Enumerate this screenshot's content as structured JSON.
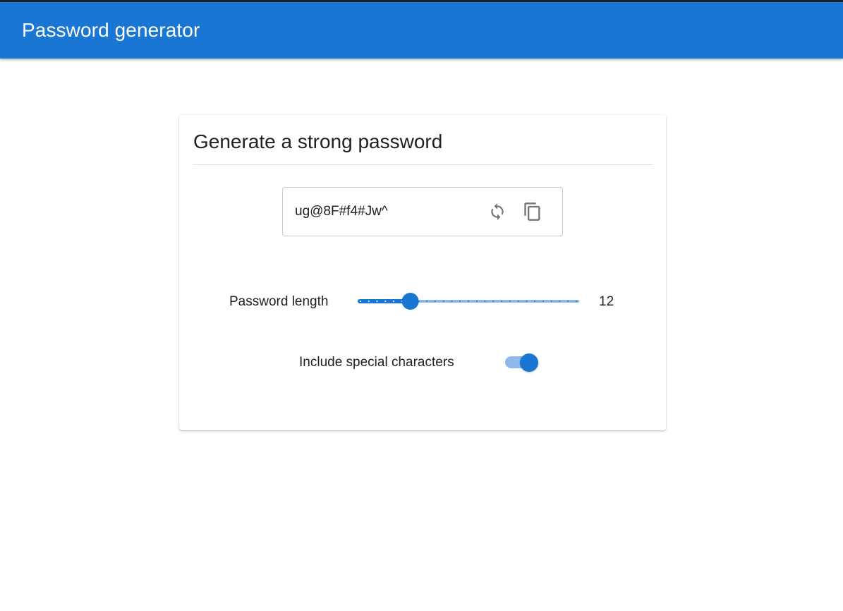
{
  "appbar": {
    "title": "Password generator"
  },
  "card": {
    "title": "Generate a strong password",
    "password": {
      "value": "ug@8F#f4#Jw^"
    },
    "length": {
      "label": "Password length",
      "value": 12,
      "display": "12",
      "min": 6,
      "max": 32,
      "step": 1
    },
    "special": {
      "label": "Include special characters",
      "enabled": true
    }
  },
  "colors": {
    "primary": "#1976d2",
    "track_light": "#8fb8e8"
  },
  "icons": {
    "refresh": "refresh-icon",
    "copy": "copy-icon"
  }
}
